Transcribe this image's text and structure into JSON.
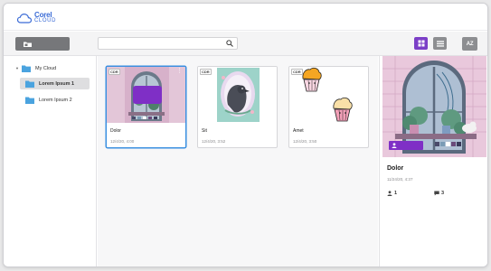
{
  "app": {
    "brand": "Corel",
    "product": "CLOUD"
  },
  "search": {
    "placeholder": "",
    "value": ""
  },
  "sort": {
    "label": "AZ"
  },
  "sidebar": {
    "root": {
      "label": "My Cloud",
      "expanded": true
    },
    "items": [
      {
        "label": "Lorem Ipsum 1",
        "selected": true
      },
      {
        "label": "Lorem Ipsum 2",
        "selected": false
      }
    ]
  },
  "files": [
    {
      "badge": "CDR",
      "title": "Dolor",
      "date": "12/4/20, 4:00",
      "selected": true
    },
    {
      "badge": "CDR",
      "title": "Sit",
      "date": "12/4/20, 3:52",
      "selected": false
    },
    {
      "badge": "CDR",
      "title": "Amet",
      "date": "12/4/20, 3:50",
      "selected": false
    }
  ],
  "details": {
    "title": "Dolor",
    "date": "11/24/20, 4:37",
    "collaborators": "1",
    "comments": "3"
  },
  "colors": {
    "accent": "#7b3fc7",
    "selection": "#3a8fe0",
    "brand": "#3a6bd6",
    "folder": "#4aa3df"
  },
  "icons": [
    "cloud-icon",
    "folder-upload-icon",
    "search-icon",
    "grid-view-icon",
    "list-view-icon",
    "folder-icon",
    "kebab-menu-icon",
    "user-share-icon",
    "comment-icon"
  ]
}
